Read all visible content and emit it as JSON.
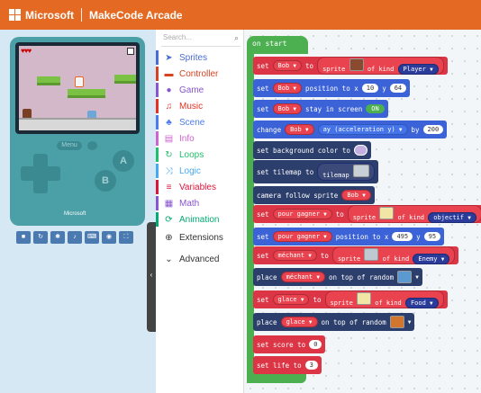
{
  "header": {
    "brand": "Microsoft",
    "product": "MakeCode Arcade"
  },
  "simulator": {
    "hearts": "♥♥♥",
    "menu_label": "Menu",
    "button_a": "A",
    "button_b": "B",
    "console_brand": "Microsoft",
    "toolbar_icons": [
      "stop-icon",
      "restart-icon",
      "debug-icon",
      "sound-icon",
      "keyboard-icon",
      "screenshot-icon",
      "fullscreen-icon"
    ]
  },
  "toolbox": {
    "search_placeholder": "Search...",
    "categories": [
      {
        "label": "Sprites",
        "icon": "paper-plane-icon",
        "color": "#4a6cd4"
      },
      {
        "label": "Controller",
        "icon": "gamepad-icon",
        "color": "#d54322"
      },
      {
        "label": "Game",
        "icon": "circle-icon",
        "color": "#8854d0"
      },
      {
        "label": "Music",
        "icon": "headphones-icon",
        "color": "#e63022"
      },
      {
        "label": "Scene",
        "icon": "tree-icon",
        "color": "#4b7bec"
      },
      {
        "label": "Info",
        "icon": "id-card-icon",
        "color": "#cf63cf"
      },
      {
        "label": "Loops",
        "icon": "refresh-icon",
        "color": "#20bf6b"
      },
      {
        "label": "Logic",
        "icon": "shuffle-icon",
        "color": "#45aaf2"
      },
      {
        "label": "Variables",
        "icon": "list-icon",
        "color": "#dc143c"
      },
      {
        "label": "Math",
        "icon": "calculator-icon",
        "color": "#8854d0"
      },
      {
        "label": "Animation",
        "icon": "sync-icon",
        "color": "#03aa74"
      },
      {
        "label": "Extensions",
        "icon": "plus-circle-icon",
        "color": "#333333"
      },
      {
        "label": "Advanced",
        "icon": "chevron-down-icon",
        "color": "#333333"
      }
    ]
  },
  "blocks": {
    "on_start": "on start",
    "b1": {
      "kw": "set",
      "var": "Bob",
      "to": "to",
      "sprite": "sprite",
      "ofkind": "of kind",
      "kind": "Player"
    },
    "b2": {
      "kw": "set",
      "var": "Bob",
      "text": "position to x",
      "x": "10",
      "y_lbl": "y",
      "y": "64"
    },
    "b3": {
      "kw": "set",
      "var": "Bob",
      "text": "stay in screen",
      "toggle": "ON"
    },
    "b4": {
      "kw": "change",
      "var": "Bob",
      "prop": "ay (acceleration y)",
      "by": "by",
      "value": "200"
    },
    "b5": {
      "text": "set background color to"
    },
    "b6": {
      "text": "set tilemap to",
      "value": "tilemap"
    },
    "b7": {
      "text": "camera follow sprite",
      "var": "Bob"
    },
    "b8": {
      "kw": "set",
      "var": "pour gagner",
      "to": "to",
      "sprite": "sprite",
      "ofkind": "of kind",
      "kind": "objectif"
    },
    "b9": {
      "kw": "set",
      "var": "pour gagner",
      "text": "position to x",
      "x": "495",
      "y_lbl": "y",
      "y": "95"
    },
    "b10": {
      "kw": "set",
      "var": "méchant",
      "to": "to",
      "sprite": "sprite",
      "ofkind": "of kind",
      "kind": "Enemy"
    },
    "b11": {
      "kw": "place",
      "var": "méchant",
      "text": "on top of random"
    },
    "b12": {
      "kw": "set",
      "var": "glace",
      "to": "to",
      "sprite": "sprite",
      "ofkind": "of kind",
      "kind": "Food"
    },
    "b13": {
      "kw": "place",
      "var": "glace",
      "text": "on top of random"
    },
    "b14": {
      "text": "set score to",
      "value": "0"
    },
    "b15": {
      "text": "set life to",
      "value": "3"
    }
  },
  "colors": {
    "header": "#e46a23",
    "loops_green": "#4caf50",
    "sprite_red": "#dc3545",
    "sprite_blue": "#3b62d6",
    "scene_navy": "#2c3e6b"
  }
}
